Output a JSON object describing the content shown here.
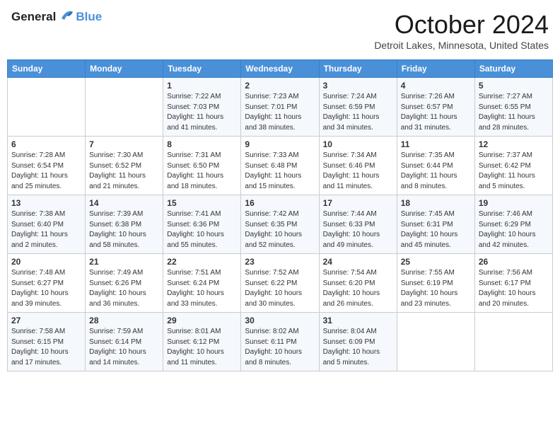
{
  "header": {
    "logo": {
      "general": "General",
      "blue": "Blue"
    },
    "title": "October 2024",
    "location": "Detroit Lakes, Minnesota, United States"
  },
  "weekdays": [
    "Sunday",
    "Monday",
    "Tuesday",
    "Wednesday",
    "Thursday",
    "Friday",
    "Saturday"
  ],
  "weeks": [
    [
      {
        "day": "",
        "sunrise": "",
        "sunset": "",
        "daylight": ""
      },
      {
        "day": "",
        "sunrise": "",
        "sunset": "",
        "daylight": ""
      },
      {
        "day": "1",
        "sunrise": "Sunrise: 7:22 AM",
        "sunset": "Sunset: 7:03 PM",
        "daylight": "Daylight: 11 hours and 41 minutes."
      },
      {
        "day": "2",
        "sunrise": "Sunrise: 7:23 AM",
        "sunset": "Sunset: 7:01 PM",
        "daylight": "Daylight: 11 hours and 38 minutes."
      },
      {
        "day": "3",
        "sunrise": "Sunrise: 7:24 AM",
        "sunset": "Sunset: 6:59 PM",
        "daylight": "Daylight: 11 hours and 34 minutes."
      },
      {
        "day": "4",
        "sunrise": "Sunrise: 7:26 AM",
        "sunset": "Sunset: 6:57 PM",
        "daylight": "Daylight: 11 hours and 31 minutes."
      },
      {
        "day": "5",
        "sunrise": "Sunrise: 7:27 AM",
        "sunset": "Sunset: 6:55 PM",
        "daylight": "Daylight: 11 hours and 28 minutes."
      }
    ],
    [
      {
        "day": "6",
        "sunrise": "Sunrise: 7:28 AM",
        "sunset": "Sunset: 6:54 PM",
        "daylight": "Daylight: 11 hours and 25 minutes."
      },
      {
        "day": "7",
        "sunrise": "Sunrise: 7:30 AM",
        "sunset": "Sunset: 6:52 PM",
        "daylight": "Daylight: 11 hours and 21 minutes."
      },
      {
        "day": "8",
        "sunrise": "Sunrise: 7:31 AM",
        "sunset": "Sunset: 6:50 PM",
        "daylight": "Daylight: 11 hours and 18 minutes."
      },
      {
        "day": "9",
        "sunrise": "Sunrise: 7:33 AM",
        "sunset": "Sunset: 6:48 PM",
        "daylight": "Daylight: 11 hours and 15 minutes."
      },
      {
        "day": "10",
        "sunrise": "Sunrise: 7:34 AM",
        "sunset": "Sunset: 6:46 PM",
        "daylight": "Daylight: 11 hours and 11 minutes."
      },
      {
        "day": "11",
        "sunrise": "Sunrise: 7:35 AM",
        "sunset": "Sunset: 6:44 PM",
        "daylight": "Daylight: 11 hours and 8 minutes."
      },
      {
        "day": "12",
        "sunrise": "Sunrise: 7:37 AM",
        "sunset": "Sunset: 6:42 PM",
        "daylight": "Daylight: 11 hours and 5 minutes."
      }
    ],
    [
      {
        "day": "13",
        "sunrise": "Sunrise: 7:38 AM",
        "sunset": "Sunset: 6:40 PM",
        "daylight": "Daylight: 11 hours and 2 minutes."
      },
      {
        "day": "14",
        "sunrise": "Sunrise: 7:39 AM",
        "sunset": "Sunset: 6:38 PM",
        "daylight": "Daylight: 10 hours and 58 minutes."
      },
      {
        "day": "15",
        "sunrise": "Sunrise: 7:41 AM",
        "sunset": "Sunset: 6:36 PM",
        "daylight": "Daylight: 10 hours and 55 minutes."
      },
      {
        "day": "16",
        "sunrise": "Sunrise: 7:42 AM",
        "sunset": "Sunset: 6:35 PM",
        "daylight": "Daylight: 10 hours and 52 minutes."
      },
      {
        "day": "17",
        "sunrise": "Sunrise: 7:44 AM",
        "sunset": "Sunset: 6:33 PM",
        "daylight": "Daylight: 10 hours and 49 minutes."
      },
      {
        "day": "18",
        "sunrise": "Sunrise: 7:45 AM",
        "sunset": "Sunset: 6:31 PM",
        "daylight": "Daylight: 10 hours and 45 minutes."
      },
      {
        "day": "19",
        "sunrise": "Sunrise: 7:46 AM",
        "sunset": "Sunset: 6:29 PM",
        "daylight": "Daylight: 10 hours and 42 minutes."
      }
    ],
    [
      {
        "day": "20",
        "sunrise": "Sunrise: 7:48 AM",
        "sunset": "Sunset: 6:27 PM",
        "daylight": "Daylight: 10 hours and 39 minutes."
      },
      {
        "day": "21",
        "sunrise": "Sunrise: 7:49 AM",
        "sunset": "Sunset: 6:26 PM",
        "daylight": "Daylight: 10 hours and 36 minutes."
      },
      {
        "day": "22",
        "sunrise": "Sunrise: 7:51 AM",
        "sunset": "Sunset: 6:24 PM",
        "daylight": "Daylight: 10 hours and 33 minutes."
      },
      {
        "day": "23",
        "sunrise": "Sunrise: 7:52 AM",
        "sunset": "Sunset: 6:22 PM",
        "daylight": "Daylight: 10 hours and 30 minutes."
      },
      {
        "day": "24",
        "sunrise": "Sunrise: 7:54 AM",
        "sunset": "Sunset: 6:20 PM",
        "daylight": "Daylight: 10 hours and 26 minutes."
      },
      {
        "day": "25",
        "sunrise": "Sunrise: 7:55 AM",
        "sunset": "Sunset: 6:19 PM",
        "daylight": "Daylight: 10 hours and 23 minutes."
      },
      {
        "day": "26",
        "sunrise": "Sunrise: 7:56 AM",
        "sunset": "Sunset: 6:17 PM",
        "daylight": "Daylight: 10 hours and 20 minutes."
      }
    ],
    [
      {
        "day": "27",
        "sunrise": "Sunrise: 7:58 AM",
        "sunset": "Sunset: 6:15 PM",
        "daylight": "Daylight: 10 hours and 17 minutes."
      },
      {
        "day": "28",
        "sunrise": "Sunrise: 7:59 AM",
        "sunset": "Sunset: 6:14 PM",
        "daylight": "Daylight: 10 hours and 14 minutes."
      },
      {
        "day": "29",
        "sunrise": "Sunrise: 8:01 AM",
        "sunset": "Sunset: 6:12 PM",
        "daylight": "Daylight: 10 hours and 11 minutes."
      },
      {
        "day": "30",
        "sunrise": "Sunrise: 8:02 AM",
        "sunset": "Sunset: 6:11 PM",
        "daylight": "Daylight: 10 hours and 8 minutes."
      },
      {
        "day": "31",
        "sunrise": "Sunrise: 8:04 AM",
        "sunset": "Sunset: 6:09 PM",
        "daylight": "Daylight: 10 hours and 5 minutes."
      },
      {
        "day": "",
        "sunrise": "",
        "sunset": "",
        "daylight": ""
      },
      {
        "day": "",
        "sunrise": "",
        "sunset": "",
        "daylight": ""
      }
    ]
  ]
}
